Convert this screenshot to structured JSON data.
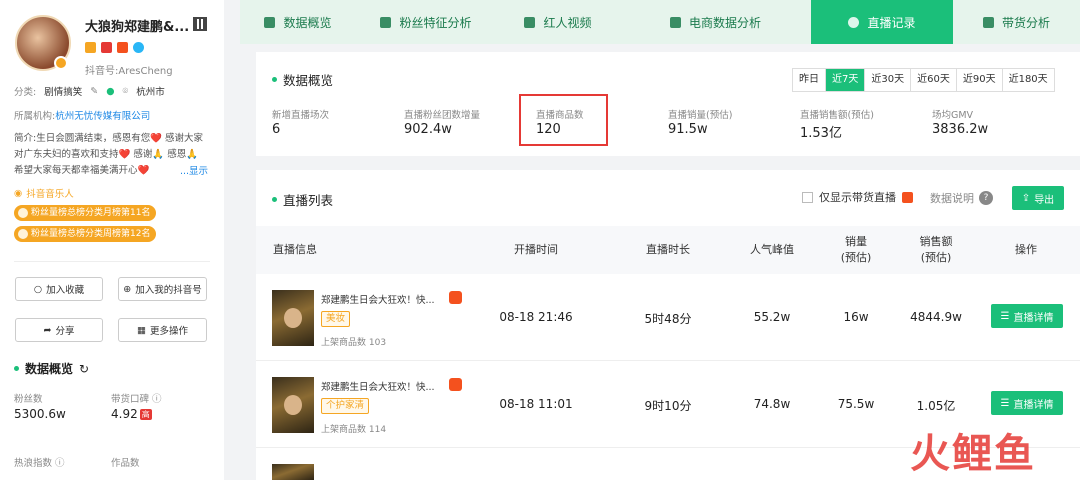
{
  "profile": {
    "name": "大狼狗郑建鹏&...",
    "douyin_id": "抖音号:AresCheng",
    "category_label": "分类:",
    "category_value": "剧情搞笑",
    "location": "杭州市",
    "org_label": "所属机构:",
    "org_value": "杭州无忧传媒有限公司",
    "bio": "简介:生日会圆满结束，感恩有您❤️ 感谢大家对广东夫妇的喜欢和支持❤️ 感谢🙏 感恩🙏 希望大家每天都幸福美满开心❤️",
    "bio_more": "...显示",
    "music_tag": "抖音音乐人",
    "rank1": "粉丝量榜总榜分类月榜第11名",
    "rank2": "粉丝量榜总榜分类周榜第12名",
    "btn_favorite": "加入收藏",
    "btn_add_douyin": "加入我的抖音号",
    "btn_share": "分享",
    "btn_more": "更多操作",
    "overview_title": "数据概览",
    "fans_label": "粉丝数",
    "fans_value": "5300.6w",
    "reputation_label": "带货口碑",
    "reputation_value": "4.92",
    "reputation_chip": "高",
    "hot_label": "热浪指数",
    "works_label": "作品数"
  },
  "tabs": [
    {
      "label": "数据概览",
      "icon": "chart-pie-icon"
    },
    {
      "label": "粉丝特征分析",
      "icon": "fans-icon"
    },
    {
      "label": "红人视频",
      "icon": "video-icon"
    },
    {
      "label": "电商数据分析",
      "icon": "cart-icon"
    },
    {
      "label": "直播记录",
      "icon": "clock-icon",
      "active": true
    },
    {
      "label": "带货分析",
      "icon": "bag-icon"
    }
  ],
  "overview": {
    "title": "数据概览",
    "ranges": [
      "昨日",
      "近7天",
      "近30天",
      "近60天",
      "近90天",
      "近180天"
    ],
    "active_range": "近7天",
    "metrics": [
      {
        "label": "新增直播场次",
        "value": "6"
      },
      {
        "label": "直播粉丝团数增量",
        "value": "902.4w"
      },
      {
        "label": "直播商品数",
        "value": "120",
        "highlighted": true
      },
      {
        "label": "直播销量(预估)",
        "value": "91.5w"
      },
      {
        "label": "直播销售额(预估)",
        "value": "1.53亿"
      },
      {
        "label": "场均GMV",
        "value": "3836.2w"
      }
    ]
  },
  "live_list": {
    "title": "直播列表",
    "only_goods_label": "仅显示带货直播",
    "help_label": "数据说明",
    "export_label": "导出",
    "columns": {
      "info": "直播信息",
      "start": "开播时间",
      "duration": "直播时长",
      "peak": "人气峰值",
      "sales_1": "销量",
      "sales_2": "(预估)",
      "gmv_1": "销售额",
      "gmv_2": "(预估)",
      "action": "操作"
    },
    "rows": [
      {
        "title": "郑建鹏生日会大狂欢！快...",
        "tag": "美妆",
        "goods": "上架商品数 103",
        "start": "08-18 21:46",
        "duration": "5时48分",
        "peak": "55.2w",
        "sales": "16w",
        "gmv": "4844.9w",
        "action": "直播详情"
      },
      {
        "title": "郑建鹏生日会大狂欢！快...",
        "tag": "个护家清",
        "goods": "上架商品数 114",
        "start": "08-18 11:01",
        "duration": "9时10分",
        "peak": "74.8w",
        "sales": "75.5w",
        "gmv": "1.05亿",
        "action": "直播详情"
      }
    ]
  },
  "watermark": "火鲤鱼",
  "colors": {
    "accent": "#1bbf7a",
    "highlight": "#e53935",
    "orange": "#f5a623"
  }
}
